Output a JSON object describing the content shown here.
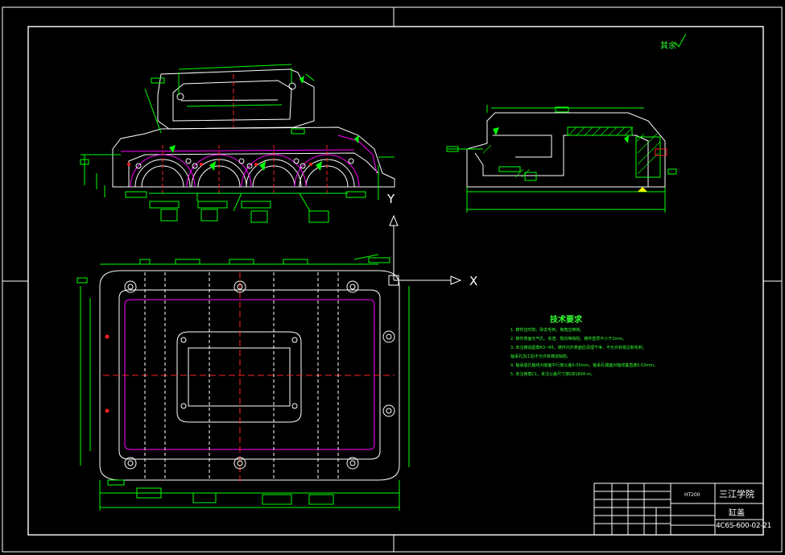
{
  "drawing": {
    "surface_finish_note": "其余",
    "tech_requirements": {
      "title": "技术要求",
      "items": [
        "1. 铸件应时效，除去毛刺，棱角应倒钝。",
        "2. 铸件表面无气孔、夹渣、裂纹等缺陷，铸件壁厚不小于2mm。",
        "3. 未注铸造圆角R3~R5，铸件内外表面应清理干净，不允许有锐边和毛刺，",
        "   轴承孔加工后不允许有铸造缺陷。",
        "4. 轴承座孔轴线对底面平行度公差0.05mm，轴承孔端面对轴线垂直度0.03mm。",
        "5. 未注倒角C1，未注公差尺寸按GB1804-m。"
      ]
    },
    "axis_labels": {
      "x": "X",
      "y": "Y"
    },
    "title_block": {
      "material": "HT200",
      "company": "三江学院",
      "part_name": "缸盖",
      "drawing_number": "4C6S-600-02-21"
    }
  },
  "colors": {
    "background": "#000000",
    "outline": "#ffffff",
    "green": "#00ff00",
    "magenta": "#ff00ff",
    "red": "#ff2020",
    "cyan": "#00ffff",
    "yellow": "#ffff00"
  }
}
